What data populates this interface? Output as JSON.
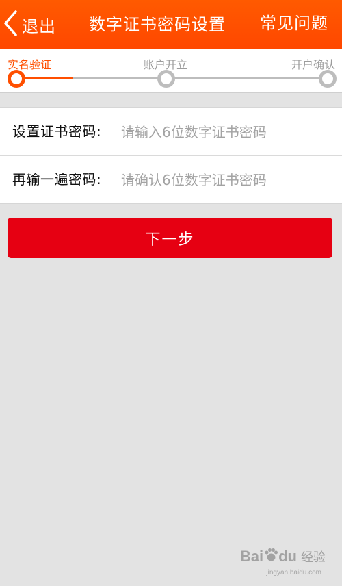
{
  "header": {
    "back_label": "退出",
    "title": "数字证书密码设置",
    "faq_label": "常见问题",
    "background_color": "#ff4f00"
  },
  "steps": [
    {
      "label": "实名验证",
      "active": true
    },
    {
      "label": "账户开立",
      "active": false
    },
    {
      "label": "开户确认",
      "active": false
    }
  ],
  "form": {
    "password_label": "设置证书密码:",
    "password_placeholder": "请输入6位数字证书密码",
    "confirm_label": "再输一遍密码:",
    "confirm_placeholder": "请确认6位数字证书密码"
  },
  "next_button_label": "下一步",
  "next_button_color": "#e60012",
  "watermark": {
    "brand": "Bai",
    "brand_suffix": "du",
    "cn": "经验",
    "sub": "jingyan.baidu.com"
  }
}
